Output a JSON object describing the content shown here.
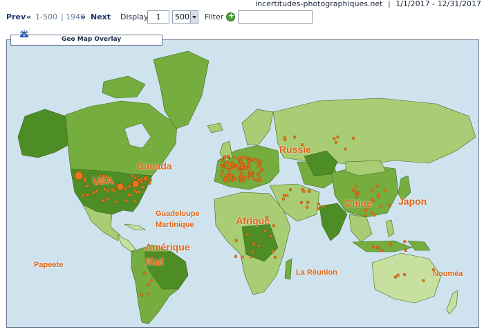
{
  "header": {
    "site_name": "incertitudes-photographiques.net",
    "separator": "|",
    "date_range": "1/1/2017 - 12/31/2017"
  },
  "pager": {
    "prev_label": "Prev",
    "prev_arrow": "«",
    "current_range": "1-500",
    "range_separator": "|",
    "total": "1940",
    "next_arrow": "»",
    "next_label": "Next",
    "display_label": "Display",
    "page_number": "1",
    "page_size": "500",
    "filter_label": "Filter",
    "filter_value": ""
  },
  "panel": {
    "title": "Geo Map Overlay",
    "icon": "globe-icon"
  },
  "map": {
    "labels": [
      {
        "text": "Canada"
      },
      {
        "text": "USA"
      },
      {
        "text": "Russie"
      },
      {
        "text": "Chine"
      },
      {
        "text": "Japon"
      },
      {
        "text": "Afrique"
      },
      {
        "text": "Guadeloupe"
      },
      {
        "text": "Martinique"
      },
      {
        "text": "Amérique"
      },
      {
        "text": "Sud"
      },
      {
        "text": "Papeete"
      },
      {
        "text": "La Réunion"
      },
      {
        "text": "Nouméa"
      }
    ]
  },
  "colors": {
    "ocean": "#cfe3ee",
    "land_dark": "#4e8d26",
    "land_mid": "#76ad3f",
    "land_light": "#a8cd74",
    "land_pale": "#c7e0a0",
    "marker": "#e8761a",
    "label": "#e06414"
  }
}
